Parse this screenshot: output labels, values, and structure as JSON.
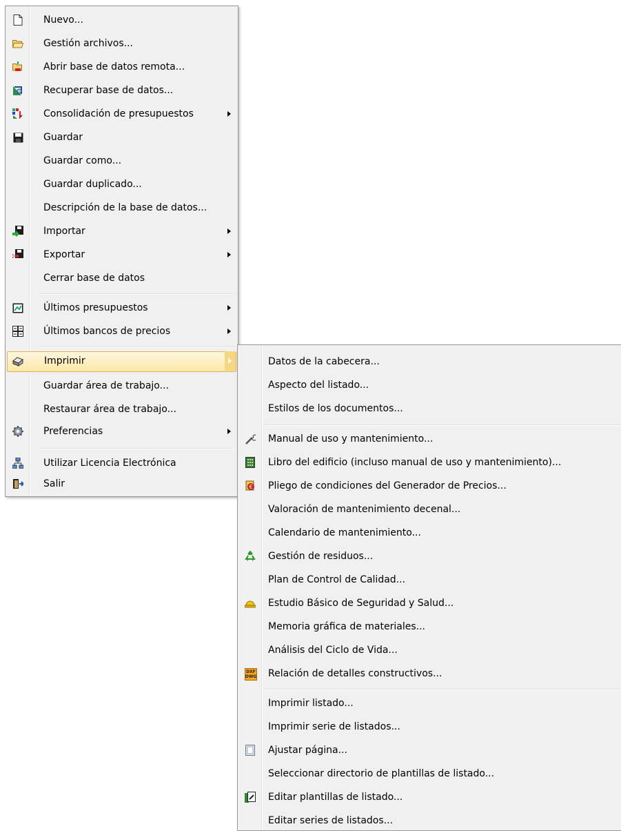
{
  "file_menu": {
    "items": [
      {
        "label": "Nuevo...",
        "icon": "new-document-icon"
      },
      {
        "label": "Gestión archivos...",
        "icon": "open-folder-icon"
      },
      {
        "label": "Abrir base de datos remota...",
        "icon": "remote-database-icon"
      },
      {
        "label": "Recuperar base de datos...",
        "icon": "recover-database-icon"
      },
      {
        "label": "Consolidación de presupuestos",
        "icon": "consolidation-icon",
        "submenu": true
      },
      {
        "label": "Guardar",
        "icon": "save-disk-icon"
      },
      {
        "label": "Guardar como..."
      },
      {
        "label": "Guardar duplicado..."
      },
      {
        "label": "Descripción de la base de datos..."
      },
      {
        "label": "Importar",
        "icon": "import-icon",
        "submenu": true
      },
      {
        "label": "Exportar",
        "icon": "export-icon",
        "submenu": true
      },
      {
        "label": "Cerrar base de datos"
      },
      {
        "label": "Últimos presupuestos",
        "icon": "recent-budgets-icon",
        "submenu": true
      },
      {
        "label": "Últimos bancos de precios",
        "icon": "recent-price-banks-icon",
        "submenu": true
      },
      {
        "label": "Imprimir",
        "icon": "printer-icon",
        "submenu": true,
        "highlighted": true
      },
      {
        "label": "Guardar área de trabajo..."
      },
      {
        "label": "Restaurar área de trabajo..."
      },
      {
        "label": "Preferencias",
        "icon": "gear-icon",
        "submenu": true
      },
      {
        "label": "Utilizar Licencia Electrónica",
        "icon": "network-license-icon"
      },
      {
        "label": "Salir",
        "icon": "exit-door-icon"
      }
    ]
  },
  "print_submenu": {
    "items": [
      {
        "label": "Datos de la cabecera..."
      },
      {
        "label": "Aspecto del listado..."
      },
      {
        "label": "Estilos de los documentos..."
      },
      {
        "label": "Manual de uso y mantenimiento...",
        "icon": "wrench-icon"
      },
      {
        "label": "Libro del edificio (incluso manual de uso y mantenimiento)...",
        "icon": "building-icon"
      },
      {
        "label": "Pliego de condiciones del Generador de Precios...",
        "icon": "scroll-euro-icon"
      },
      {
        "label": "Valoración de mantenimiento decenal..."
      },
      {
        "label": "Calendario de mantenimiento..."
      },
      {
        "label": "Gestión de residuos...",
        "icon": "recycle-icon"
      },
      {
        "label": "Plan de Control de Calidad..."
      },
      {
        "label": "Estudio Básico de Seguridad y Salud...",
        "icon": "hard-hat-icon"
      },
      {
        "label": "Memoria gráfica de materiales..."
      },
      {
        "label": "Análisis del Ciclo de Vida..."
      },
      {
        "label": "Relación de detalles constructivos...",
        "icon": "dxf-dwg-icon"
      },
      {
        "label": "Imprimir listado..."
      },
      {
        "label": "Imprimir serie de listados..."
      },
      {
        "label": "Ajustar página...",
        "icon": "page-setup-icon"
      },
      {
        "label": "Seleccionar directorio de plantillas de listado..."
      },
      {
        "label": "Editar plantillas de listado...",
        "icon": "edit-template-icon"
      },
      {
        "label": "Editar series de listados..."
      }
    ],
    "dxf_icon_text_top": "DXF",
    "dxf_icon_text_bottom": "DWG"
  }
}
